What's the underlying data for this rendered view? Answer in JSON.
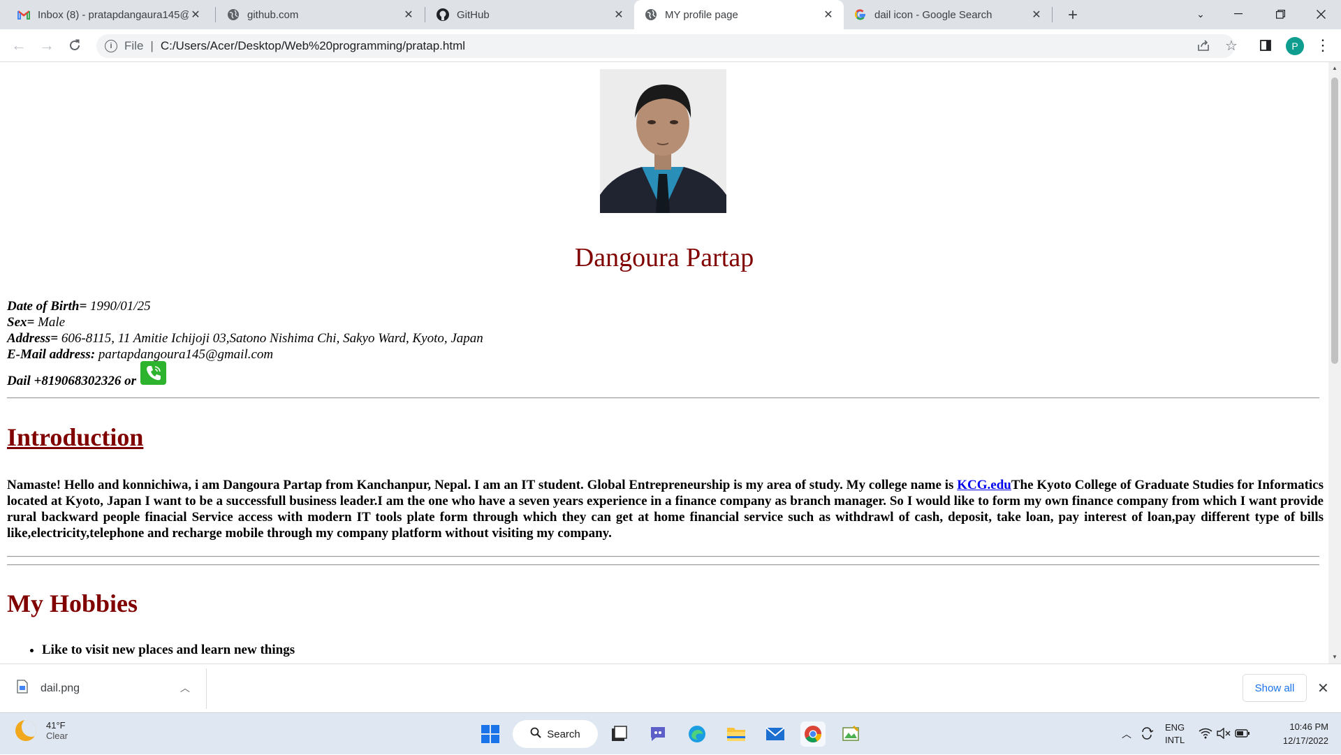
{
  "browser": {
    "tabs": [
      {
        "title": "Inbox (8) - pratapdangaura145@",
        "icon": "gmail-icon",
        "active": false
      },
      {
        "title": "github.com",
        "icon": "globe-icon",
        "active": false
      },
      {
        "title": "GitHub",
        "icon": "github-icon",
        "active": false
      },
      {
        "title": "MY profile page",
        "icon": "globe-icon",
        "active": true
      },
      {
        "title": "dail icon - Google Search",
        "icon": "google-icon",
        "active": false
      }
    ],
    "address": {
      "scheme_label": "File",
      "url": "C:/Users/Acer/Desktop/Web%20programming/pratap.html"
    },
    "profile_initial": "P"
  },
  "page": {
    "name": "Dangoura Partap",
    "info": {
      "dob_label": "Date of Birth=",
      "dob_value": " 1990/01/25",
      "sex_label": "Sex=",
      "sex_value": " Male",
      "address_label": "Address=",
      "address_value": " 606-8115, 11 Amitie Ichijoji 03,Satono Nishima Chi, Sakyo Ward, Kyoto, Japan",
      "email_label": "E-Mail address:",
      "email_value": " partapdangoura145@gmail.com",
      "dial_text": "Dail +819068302326 or"
    },
    "intro": {
      "heading": "Introduction",
      "text_before": "Namaste! Hello and konnichiwa, i am Dangoura Partap from Kanchanpur, Nepal. I am an IT student. Global Entrepreneurship is my area of study. My college name is ",
      "link": "KCG.edu",
      "text_after": "The Kyoto College of Graduate Studies for Informatics located at Kyoto, Japan I want to be a successfull business leader.I am the one who have a seven years experience in a finance company as branch manager. So I would like to form my own finance company from which I want provide rural backward people finacial Service access with modern IT tools plate form through which they can get at home financial service such as withdrawl of cash, deposit, take loan, pay interest of loan,pay different type of bills like,electricity,telephone and recharge mobile through my company platform without visiting my company."
    },
    "hobbies": {
      "heading": "My Hobbies",
      "items": [
        "Like to visit new places and learn new things"
      ]
    }
  },
  "downloads": {
    "file": "dail.png",
    "show_all": "Show all"
  },
  "taskbar": {
    "temp": "41°F",
    "condition": "Clear",
    "search": "Search",
    "lang1": "ENG",
    "lang2": "INTL",
    "time": "10:46 PM",
    "date": "12/17/2022"
  }
}
